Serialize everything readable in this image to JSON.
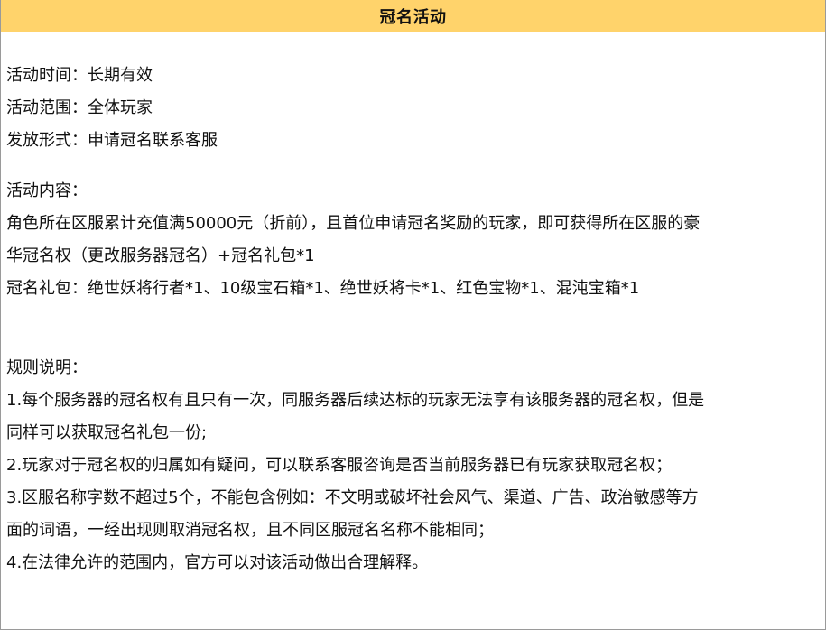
{
  "header": {
    "title": "冠名活动"
  },
  "info": {
    "time": "活动时间：长期有效",
    "scope": "活动范围：全体玩家",
    "form": "发放形式：申请冠名联系客服"
  },
  "content": {
    "heading": "活动内容：",
    "desc_line1": "角色所在区服累计充值满50000元（折前），且首位申请冠名奖励的玩家，即可获得所在区服的豪",
    "desc_line2": "华冠名权（更改服务器冠名）+冠名礼包*1",
    "gift": "冠名礼包：绝世妖将行者*1、10级宝石箱*1、绝世妖将卡*1、红色宝物*1、混沌宝箱*1"
  },
  "rules": {
    "heading": "规则说明：",
    "r1_line1": "1.每个服务器的冠名权有且只有一次，同服务器后续达标的玩家无法享有该服务器的冠名权，但是",
    "r1_line2": "同样可以获取冠名礼包一份;",
    "r2": "2.玩家对于冠名权的归属如有疑问，可以联系客服咨询是否当前服务器已有玩家获取冠名权；",
    "r3_line1": "3.区服名称字数不超过5个，不能包含例如：不文明或破坏社会风气、渠道、广告、政治敏感等方",
    "r3_line2": "面的词语，一经出现则取消冠名权，且不同区服冠名名称不能相同；",
    "r4": "4.在法律允许的范围内，官方可以对该活动做出合理解释。"
  }
}
